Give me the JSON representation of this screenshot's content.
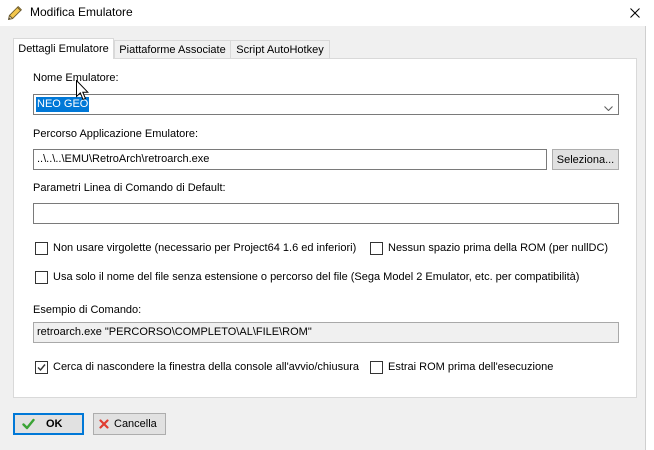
{
  "window": {
    "title": "Modifica Emulatore",
    "title_icon": "pencil-icon",
    "close_icon": "close-icon"
  },
  "tabs": [
    {
      "label": "Dettagli Emulatore",
      "selected": true
    },
    {
      "label": "Piattaforme Associate",
      "selected": false
    },
    {
      "label": "Script AutoHotkey",
      "selected": false
    }
  ],
  "details": {
    "emulator_name": {
      "label": "Nome Emulatore:",
      "value": "NEO GEO",
      "text_selected": true,
      "dropdown_icon": "chevron-down-icon"
    },
    "application_path": {
      "label": "Percorso Applicazione Emulatore:",
      "value": "..\\..\\..\\EMU\\RetroArch\\retroarch.exe",
      "browse_button": "Seleziona..."
    },
    "default_parameters": {
      "label": "Parametri Linea di Comando di Default:",
      "value": ""
    },
    "options": [
      {
        "label": "Non usare virgolette (necessario per Project64 1.6 ed inferiori)",
        "checked": false
      },
      {
        "label": "Nessun spazio prima della ROM (per nullDC)",
        "checked": false
      },
      {
        "label": "Usa solo il nome del file senza estensione o percorso del file (Sega Model 2 Emulator, etc. per compatibilità)",
        "checked": false
      }
    ],
    "command_example": {
      "label": "Esempio di Comando:",
      "value": "retroarch.exe \"PERCORSO\\COMPLETO\\AL\\FILE\\ROM\""
    },
    "startup_options": [
      {
        "label": "Cerca di nascondere la finestra della console all'avvio/chiusura",
        "checked": true
      },
      {
        "label": "Estrai ROM prima dell'esecuzione",
        "checked": false
      }
    ]
  },
  "buttons": {
    "ok": {
      "label": "OK",
      "icon": "checkmark-icon"
    },
    "cancel": {
      "label": "Cancella",
      "icon": "cross-icon"
    }
  },
  "cursor": {
    "icon": "mouse-pointer-icon"
  },
  "colors": {
    "accent": "#0078D7",
    "ok-icon": "#3AA335",
    "cancel-icon": "#E03C31"
  }
}
